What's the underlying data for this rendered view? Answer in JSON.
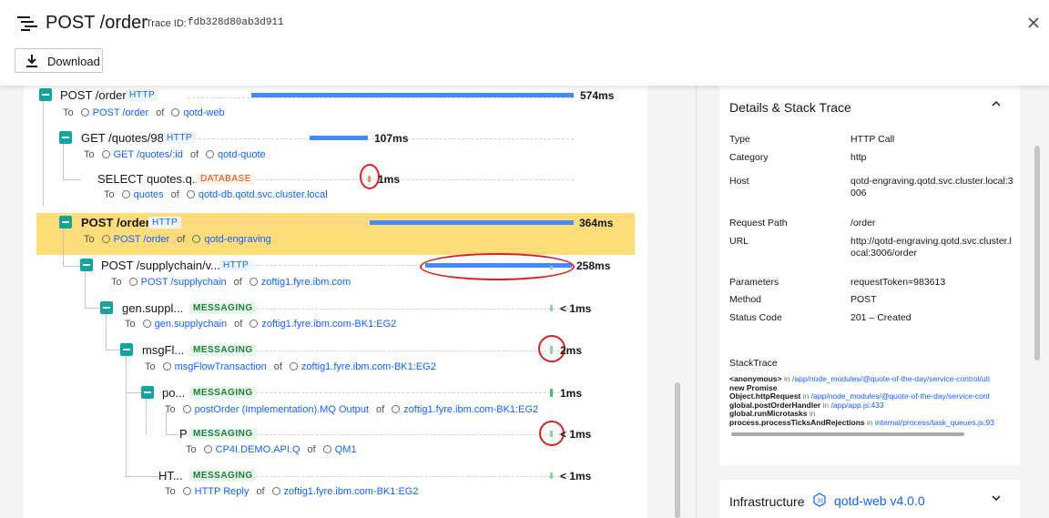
{
  "header": {
    "title": "POST /order",
    "trace_label": "Trace ID:",
    "trace_id": "fdb328d80ab3d911",
    "download_label": "Download"
  },
  "spans": [
    {
      "name": "POST /order",
      "tag": "HTTP",
      "to": "To",
      "target": "POST /order",
      "of": "of",
      "service": "qotd-web",
      "duration": "574ms"
    },
    {
      "name": "GET /quotes/98",
      "tag": "HTTP",
      "to": "To",
      "target": "GET /quotes/:id",
      "of": "of",
      "service": "qotd-quote",
      "duration": "107ms"
    },
    {
      "name": "SELECT quotes.q...",
      "tag": "DATABASE",
      "to": "To",
      "target": "quotes",
      "of": "of",
      "service": "qotd-db.qotd.svc.cluster.local",
      "duration": "1ms"
    },
    {
      "name": "POST /order",
      "tag": "HTTP",
      "to": "To",
      "target": "POST /order",
      "of": "of",
      "service": "qotd-engraving",
      "duration": "364ms"
    },
    {
      "name": "POST /supplychain/v...",
      "tag": "HTTP",
      "to": "To",
      "target": "POST /supplychain",
      "of": "of",
      "service": "zoftig1.fyre.ibm.com",
      "duration": "258ms"
    },
    {
      "name": "gen.suppl...",
      "tag": "MESSAGING",
      "to": "To",
      "target": "gen.supplychain",
      "of": "of",
      "service": "zoftig1.fyre.ibm.com-BK1:EG2",
      "duration": "< 1ms"
    },
    {
      "name": "msgFl...",
      "tag": "MESSAGING",
      "to": "To",
      "target": "msgFlowTransaction",
      "of": "of",
      "service": "zoftig1.fyre.ibm.com-BK1:EG2",
      "duration": "2ms"
    },
    {
      "name": "po...",
      "tag": "MESSAGING",
      "to": "To",
      "target": "postOrder (Implementation).MQ Output",
      "of": "of",
      "service": "zoftig1.fyre.ibm.com-BK1:EG2",
      "duration": "1ms"
    },
    {
      "name": "P",
      "tag": "MESSAGING",
      "to": "To",
      "target": "CP4I.DEMO.API.Q",
      "of": "of",
      "service": "QM1",
      "duration": "< 1ms"
    },
    {
      "name": "HT...",
      "tag": "MESSAGING",
      "to": "To",
      "target": "HTTP Reply",
      "of": "of",
      "service": "zoftig1.fyre.ibm.com-BK1:EG2",
      "duration": "< 1ms"
    }
  ],
  "details": {
    "title": "Details & Stack Trace",
    "rows": [
      {
        "key": "Type",
        "value": "HTTP Call"
      },
      {
        "key": "Category",
        "value": "http"
      },
      {
        "key": "Host",
        "value": "qotd-engraving.qotd.svc.cluster.local:3006"
      },
      {
        "key": "Request Path",
        "value": "/order"
      },
      {
        "key": "URL",
        "value": "http://qotd-engraving.qotd.svc.cluster.local:3006/order"
      },
      {
        "key": "Parameters",
        "value": "requestToken=983613"
      },
      {
        "key": "Method",
        "value": "POST"
      },
      {
        "key": "Status Code",
        "value": "201 – Created"
      }
    ],
    "stack_title": "StackTrace",
    "stack": [
      {
        "fn": "<anonymous>",
        "in": "in",
        "loc": "/app/node_modules/@quote-of-the-day/service-control/uti"
      },
      {
        "fn": "new Promise",
        "in": "",
        "loc": ""
      },
      {
        "fn": "Object.httpRequest",
        "in": "in",
        "loc": "/app/node_modules/@quote-of-the-day/service-cont"
      },
      {
        "fn": "global.postOrderHandler",
        "in": "in",
        "loc": "/app/app.js:433"
      },
      {
        "fn": "global.runMicrotasks",
        "in": "in",
        "loc": ""
      },
      {
        "fn": "process.processTicksAndRejections",
        "in": "in",
        "loc": "internal/process/task_queues.js:93"
      }
    ]
  },
  "infrastructure": {
    "title": "Infrastructure",
    "link": "qotd-web v4.0.0"
  }
}
